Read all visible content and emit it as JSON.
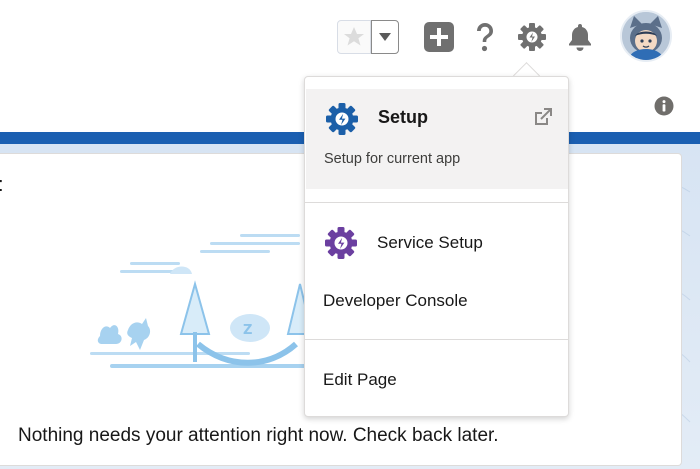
{
  "header": {
    "favorites": {
      "star_icon": "star-icon",
      "dropdown_icon": "chevron-down-icon"
    },
    "icons": [
      "plus-icon",
      "help-icon",
      "gear-icon",
      "bell-icon"
    ],
    "avatar_icon": "user-avatar"
  },
  "info_icon": "info-icon",
  "setup_menu": {
    "setup": {
      "label": "Setup",
      "subtitle": "Setup for current app",
      "icon": "setup-gear-icon",
      "open_new_icon": "external-link-icon"
    },
    "service_setup": {
      "label": "Service Setup",
      "icon": "service-setup-gear-icon"
    },
    "developer_console": {
      "label": "Developer Console"
    },
    "edit_page": {
      "label": "Edit Page"
    }
  },
  "card": {
    "empty_message": "Nothing needs your attention right now. Check back later."
  },
  "colors": {
    "band_blue": "#1b5fb1",
    "setup_icon": "#1b5fa8",
    "service_icon": "#6b3fa0",
    "menu_highlight": "#f3f2f2"
  }
}
